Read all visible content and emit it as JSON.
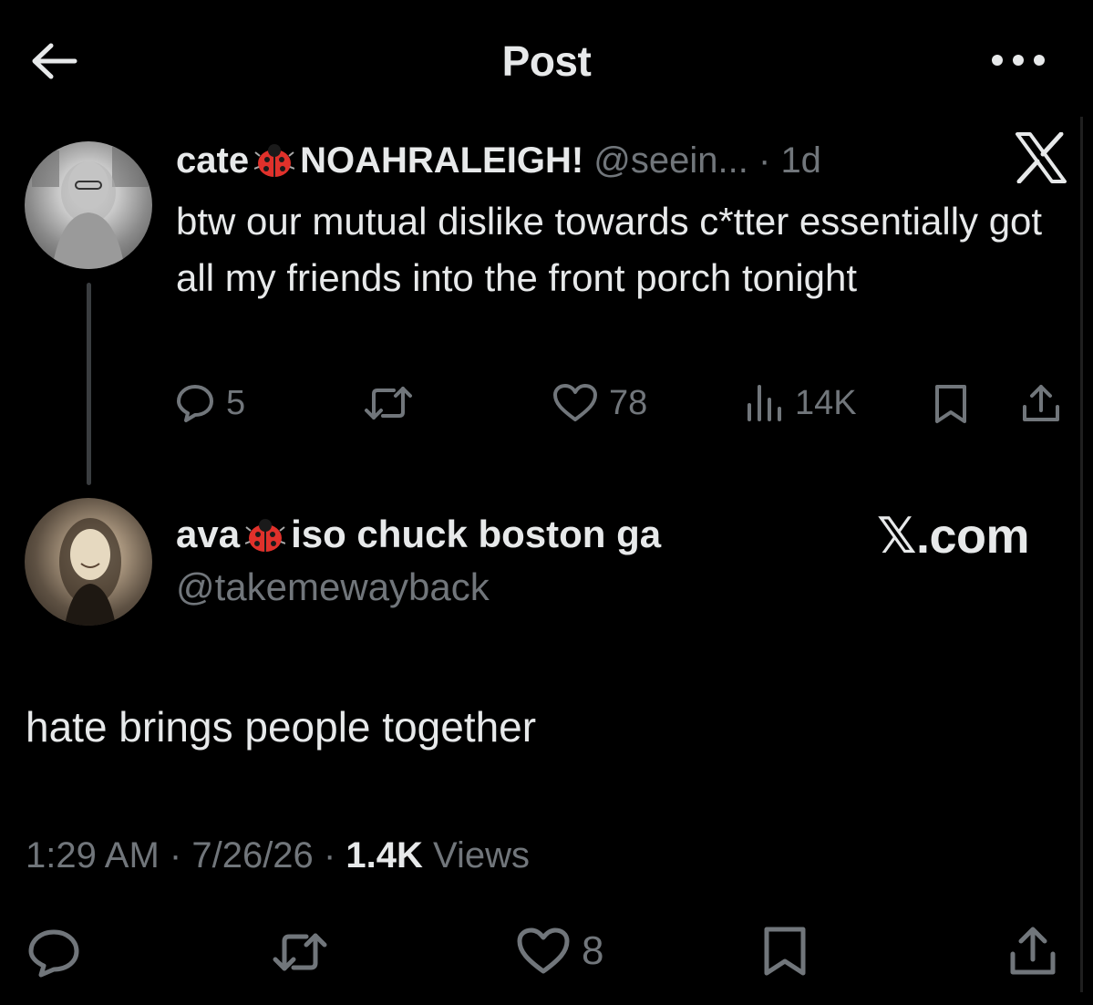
{
  "header": {
    "title": "Post",
    "back_icon": "arrow-left-icon",
    "more_icon": "ellipsis-icon"
  },
  "parent_post": {
    "display_name_1": "cate",
    "display_name_emoji": "ladybug",
    "display_name_2": "NOAHRALEIGH!",
    "handle": "@seein...",
    "separator": "·",
    "age": "1d",
    "text": "btw our mutual dislike towards c*tter essentially got all my friends into the front porch tonight",
    "replies": "5",
    "reposts": "",
    "likes": "78",
    "views": "14K",
    "brand_icon": "x-logo-icon"
  },
  "reply_post": {
    "display_name_1": "ava",
    "display_name_emoji": "ladybug",
    "display_name_2": "iso chuck boston ga",
    "handle": "@takemewayback",
    "watermark": "𝕏.com",
    "text": "hate brings people together",
    "time": "1:29 AM",
    "sep_1": "·",
    "date": "7/26/26",
    "sep_2": "·",
    "views_count": "1.4K",
    "views_label": "Views",
    "likes": "8"
  },
  "colors": {
    "background": "#000000",
    "text": "#e7e9ea",
    "muted": "#71767b",
    "thread_line": "#3a3d40"
  }
}
